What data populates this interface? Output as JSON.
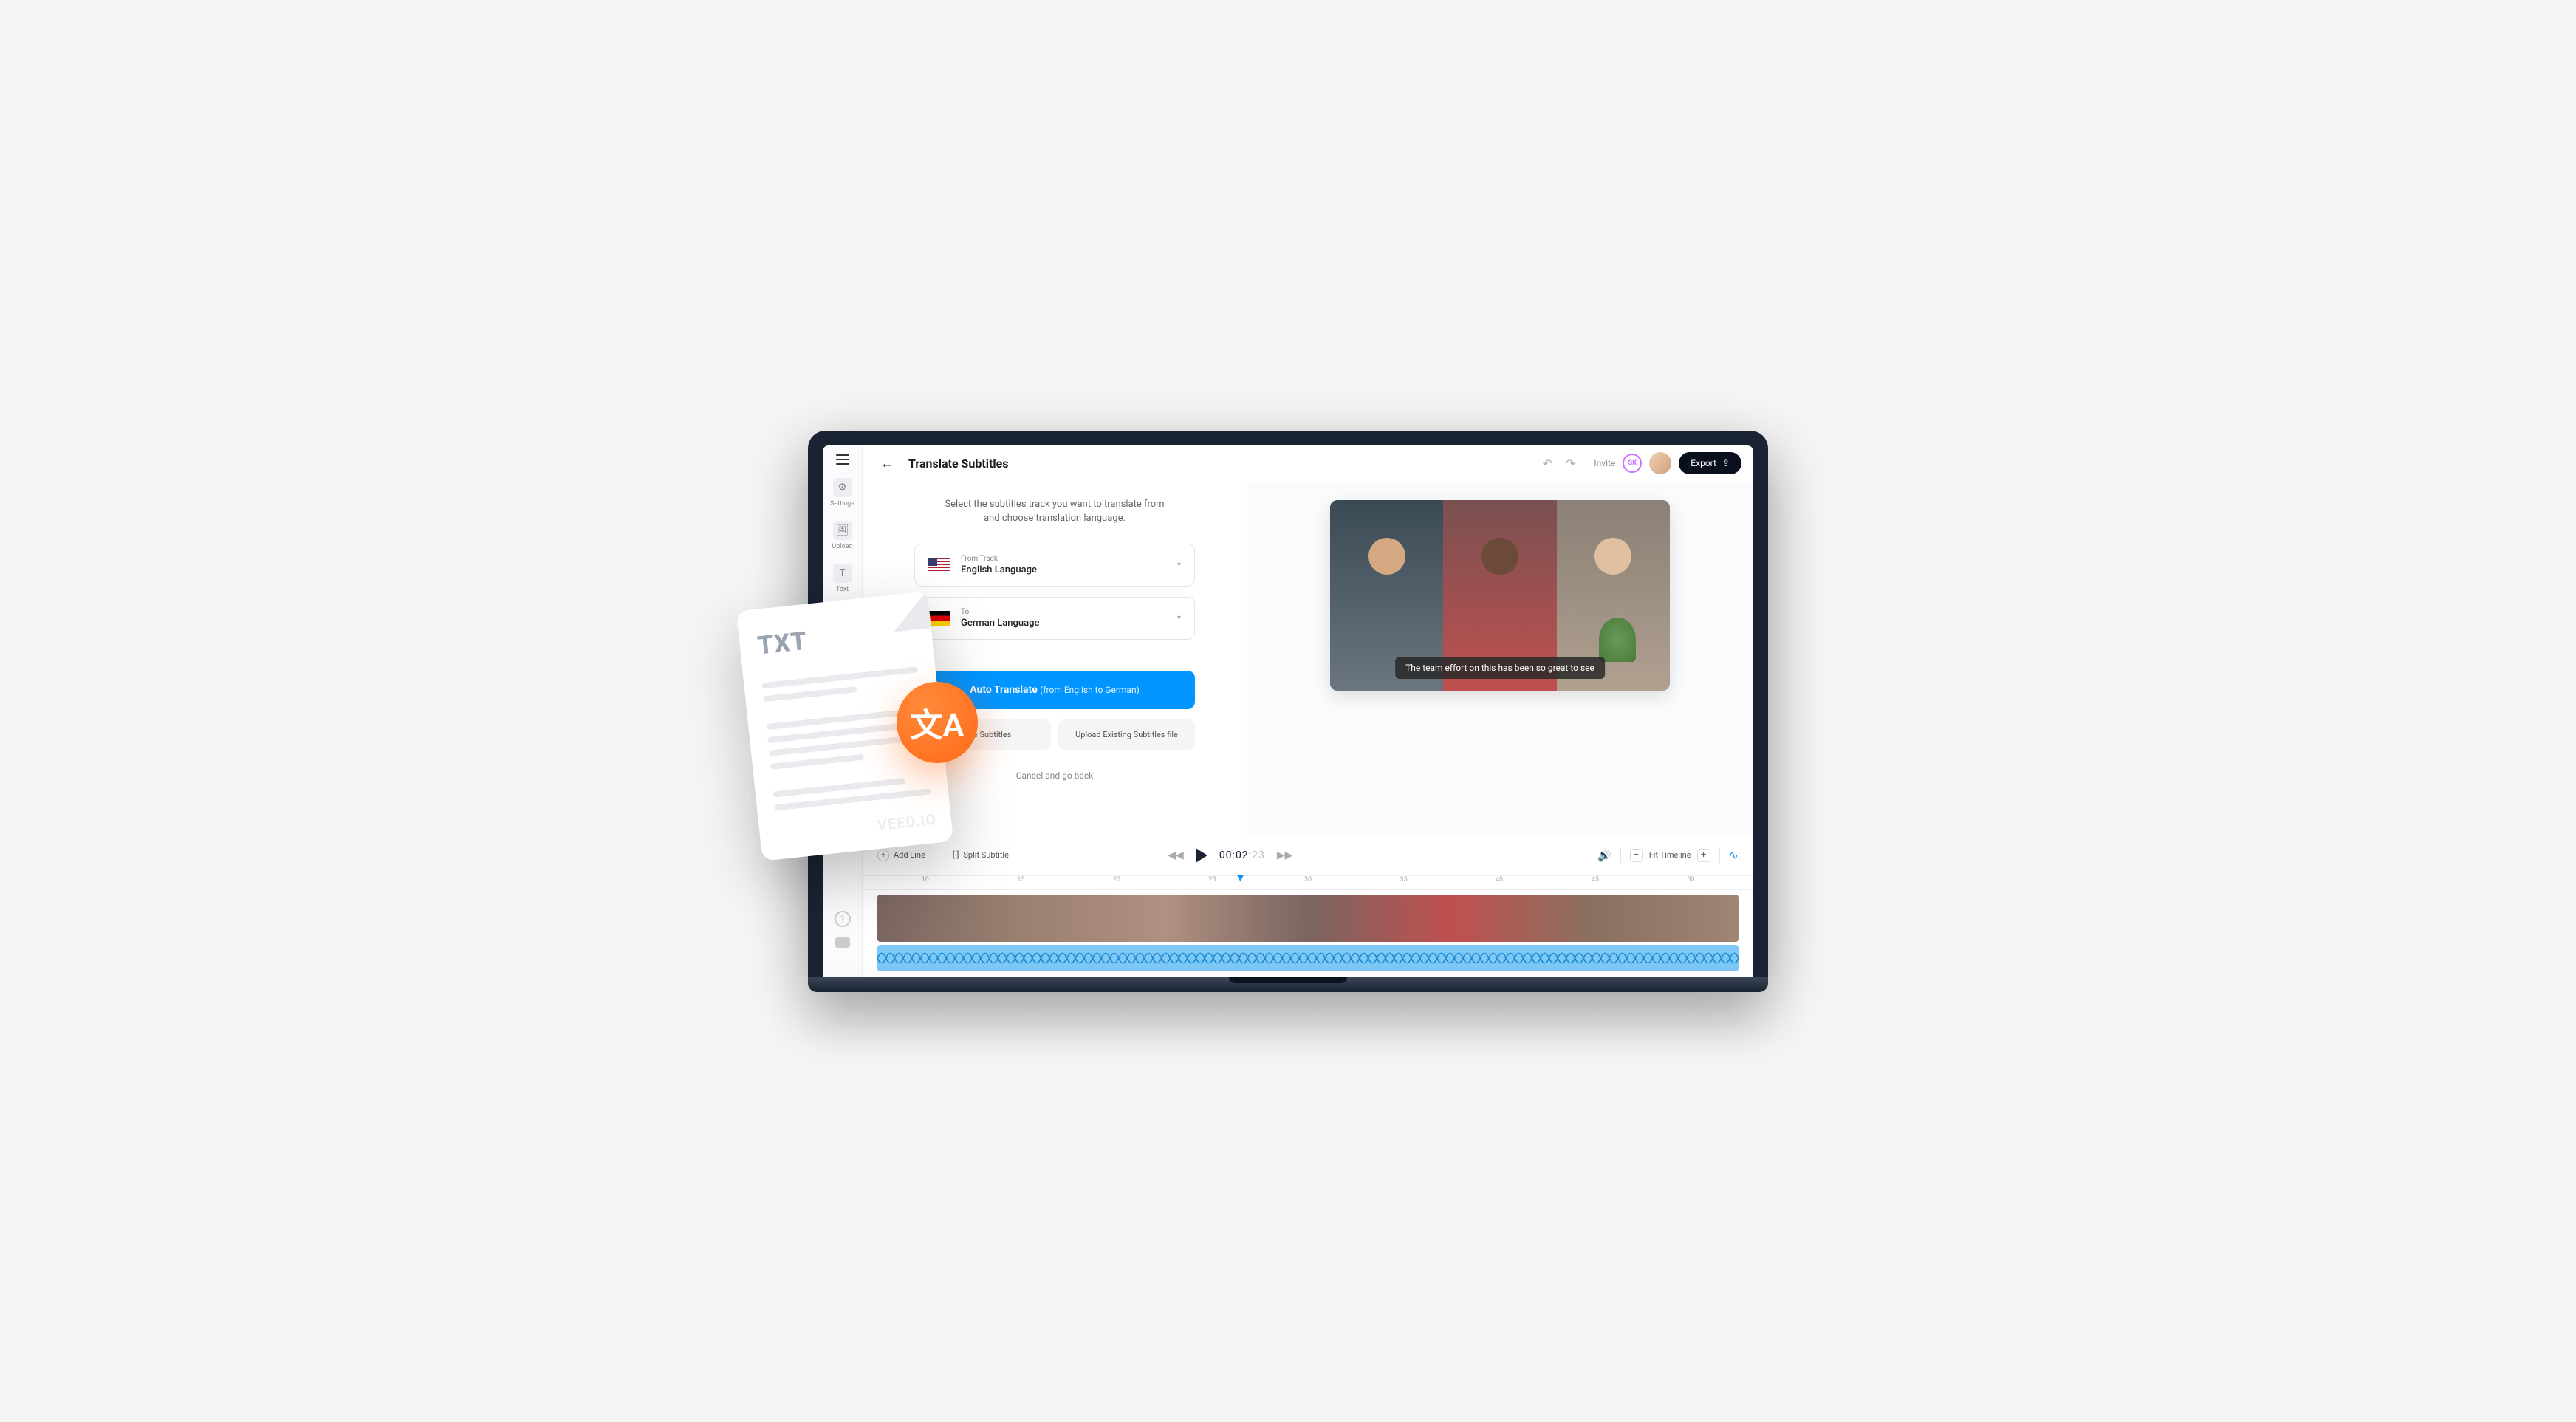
{
  "header": {
    "title": "Translate Subtitles",
    "invite": "Invite",
    "avatar_initials": "SK",
    "export": "Export"
  },
  "sidebar": {
    "items": [
      {
        "label": "Settings"
      },
      {
        "label": "Upload"
      },
      {
        "label": "Text"
      }
    ]
  },
  "panel": {
    "subtitle": "Select the subtitles track you want to translate from and choose translation language.",
    "from_label": "From Track",
    "from_value": "English Language",
    "to_label": "To",
    "to_value": "German Language",
    "primary_main": "Auto Translate",
    "primary_sub": "(from English to German)",
    "secondary_a": "Create Subtitles",
    "secondary_b": "Upload Existing Subtitles file",
    "cancel": "Cancel and go back"
  },
  "preview": {
    "caption": "The team effort on this has been so great to see"
  },
  "timeline": {
    "add_line": "Add Line",
    "split": "Split Subtitle",
    "time_main": "00:02:",
    "time_faded": "23",
    "fit": "Fit Timeline",
    "ticks": [
      "10",
      "15",
      "20",
      "25",
      "30",
      "35",
      "40",
      "45",
      "50"
    ]
  },
  "overlay": {
    "doc_label": "TXT",
    "watermark": "VEED.IO",
    "badge_text": "文A"
  }
}
